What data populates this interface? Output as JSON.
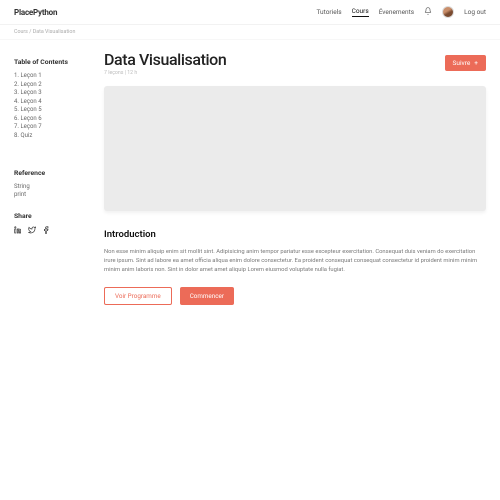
{
  "header": {
    "brand": "PlacePython",
    "nav": [
      "Tutoriels",
      "Cours",
      "Évenements"
    ],
    "active_nav_index": 1,
    "logout": "Log out"
  },
  "breadcrumb": "Cours / Data Visualisation",
  "sidebar": {
    "toc_heading": "Table of Contents",
    "toc": [
      "1. Leçon 1",
      "2. Leçon 2",
      "3. Leçon 3",
      "4. Leçon 4",
      "5. Leçon 5",
      "6. Leçon 6",
      "7. Leçon 7",
      "8. Quiz"
    ],
    "ref_heading": "Reference",
    "refs": [
      "String",
      "print"
    ],
    "share_heading": "Share"
  },
  "course": {
    "title": "Data Visualisation",
    "meta": "7 leçons |  12 h",
    "follow_label": "Suivre",
    "intro_heading": "Introduction",
    "intro_body": "Non esse minim aliquip enim sit mollit sint. Adipisicing anim tempor pariatur esse excepteur exercitation. Consequat duis veniam do exercitation irure ipsum. Sint ad labore ea amet officia aliqua enim dolore consectetur. Ea proident consequat consequat consectetur id proident minim minim minim anim laboris non. Sint in dolor amet amet aliquip Lorem eiusmod voluptate nulla fugiat.",
    "program_btn": "Voir Programme",
    "start_btn": "Commencer"
  },
  "colors": {
    "accent": "#ec6b58"
  }
}
